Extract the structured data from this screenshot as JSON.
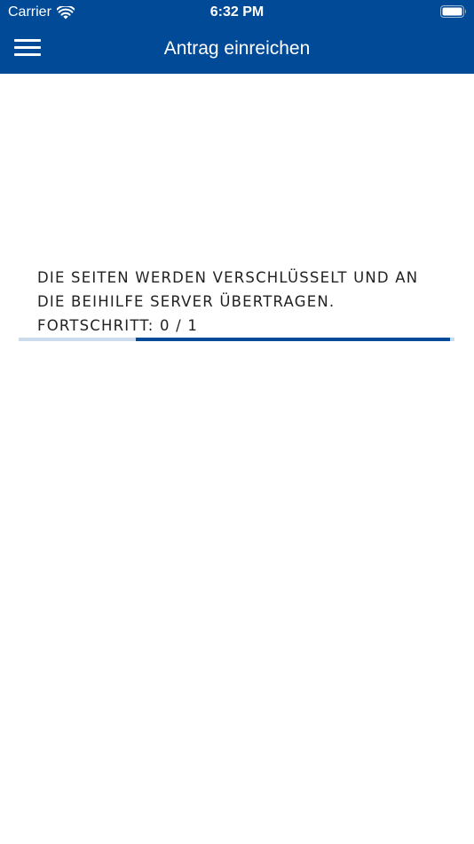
{
  "status_bar": {
    "carrier": "Carrier",
    "time": "6:32 PM"
  },
  "nav": {
    "title": "Antrag einreichen",
    "menu_icon": "hamburger-menu-icon"
  },
  "upload": {
    "line1": "DIE SEITEN WERDEN VERSCHLÜSSELT UND AN",
    "line2": "DIE BEIHILFE SERVER ÜBERTRAGEN.",
    "progress_label": "FORTSCHRITT: 0 / 1",
    "indicator": "indeterminate"
  },
  "colors": {
    "brand": "#004a97",
    "progress_track": "#ccdcec",
    "text": "#222222",
    "background": "#ffffff"
  }
}
